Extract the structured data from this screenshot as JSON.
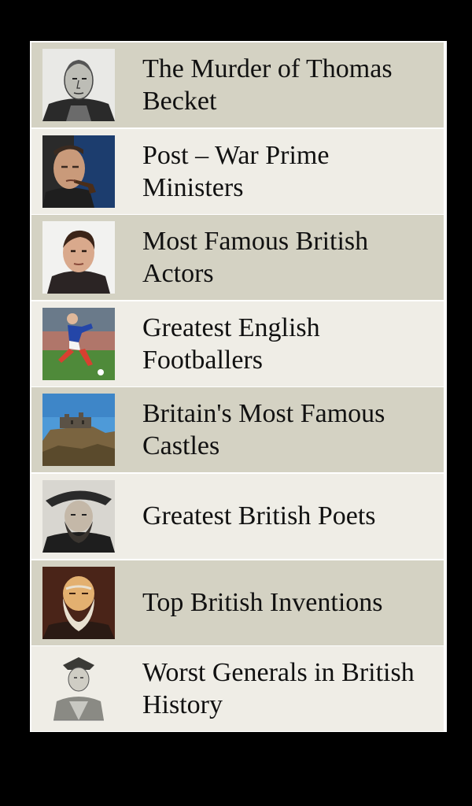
{
  "colors": {
    "background": "#000000",
    "frame": "#ffffff",
    "row_dark": "#d4d2c3",
    "row_light": "#efede6",
    "text": "#111111"
  },
  "topics": [
    {
      "title": "The Murder of Thomas Becket",
      "icon": "thomas-becket-portrait-icon"
    },
    {
      "title": "Post – War Prime Ministers",
      "icon": "prime-minister-pipe-portrait-icon"
    },
    {
      "title": "Most Famous British Actors",
      "icon": "actor-portrait-icon"
    },
    {
      "title": "Greatest English Footballers",
      "icon": "footballer-photo-icon"
    },
    {
      "title": "Britain's Most Famous Castles",
      "icon": "castle-photo-icon"
    },
    {
      "title": "Greatest British Poets",
      "icon": "poet-portrait-icon"
    },
    {
      "title": "Top British Inventions",
      "icon": "inventor-portrait-icon"
    },
    {
      "title": "Worst Generals in British History",
      "icon": "general-engraving-icon"
    }
  ]
}
